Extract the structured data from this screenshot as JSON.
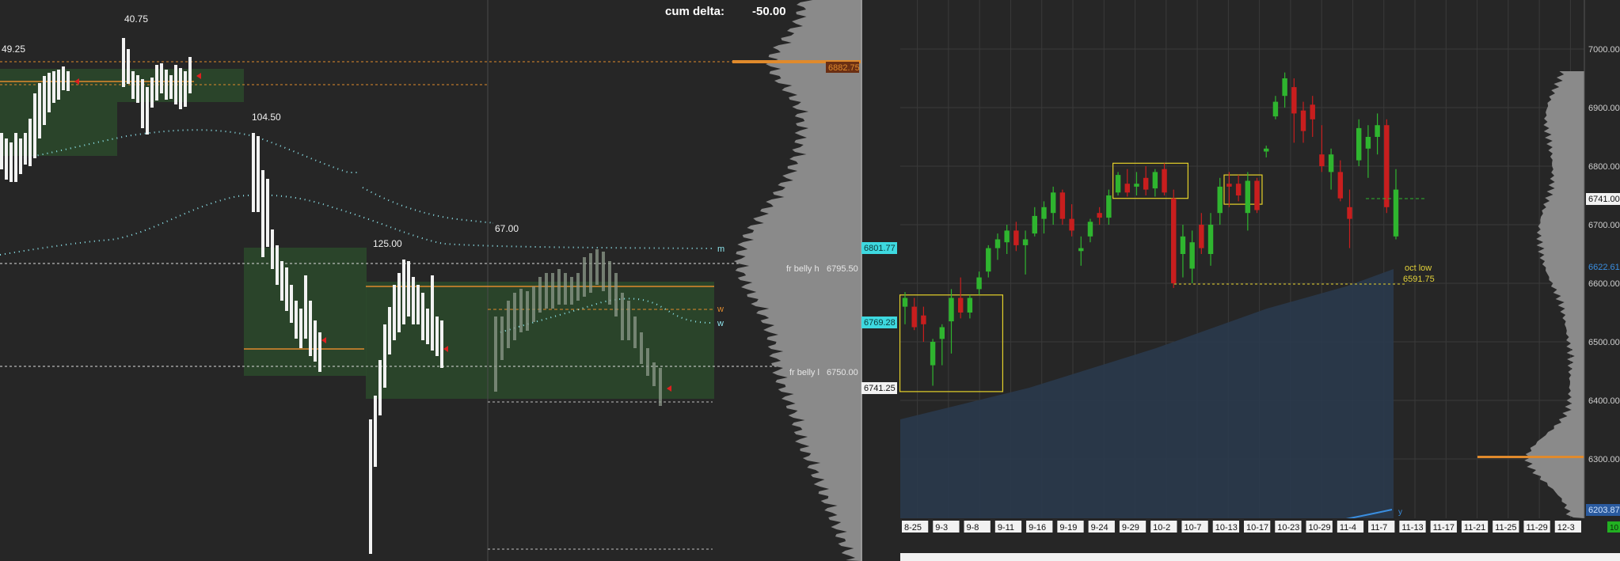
{
  "colors": {
    "background": "#262626",
    "grid": "#3a3a3a",
    "bull": "#2fb52f",
    "bear": "#c81e1e",
    "box_yellow": "#e6d22a",
    "cyan": "#8ee6ee",
    "orange": "#e08a2c",
    "profile_gray": "#8a8a8a",
    "value_area": "#2c4a2c",
    "vwap_fill": "#2a3a4c"
  },
  "icons": {
    "tpo_marker": "red-triangle-icon"
  },
  "left_panel": {
    "cum_delta_label": "cum delta:",
    "cum_delta_value": "-50.00",
    "session_labels": [
      "49.25",
      "40.75",
      "104.50",
      "125.00",
      "67.00"
    ],
    "level_lines": [
      {
        "label": "",
        "value": "6882.75",
        "tag": "6882.75"
      },
      {
        "label": "fr belly h",
        "value": "6795.50"
      },
      {
        "label": "fr belly l",
        "value": "6750.00"
      }
    ],
    "line_markers": [
      "m",
      "w",
      "w"
    ]
  },
  "right_panel": {
    "left_price_tags": [
      "6801.77",
      "6769.28",
      "6741.25"
    ],
    "annotation_label": "oct low",
    "annotation_value": "6591.75",
    "axis_tags": {
      "last_price": "6741.00",
      "profile_level": "6622.61",
      "bottom_level": "6203.87",
      "corner_tag": "10"
    },
    "series_marker": "y"
  },
  "chart_data": [
    {
      "type": "bar",
      "title": "",
      "description_of_content": "Intraday TPO/footprint price ladder with volume profile",
      "xlabel": "",
      "ylabel": "",
      "annotations": [
        "cum delta: -50.00",
        "49.25",
        "40.75",
        "104.50",
        "125.00",
        "67.00",
        "6882.75",
        "fr belly h 6795.50",
        "fr belly l 6750.00",
        "m",
        "w",
        "w"
      ]
    },
    {
      "type": "candlestick",
      "title": "",
      "xlabel": "",
      "ylabel": "",
      "x_ticks": [
        "8-25",
        "9-3",
        "9-8",
        "9-11",
        "9-16",
        "9-19",
        "9-24",
        "9-29",
        "10-2",
        "10-7",
        "10-13",
        "10-17",
        "10-23",
        "10-29",
        "11-4",
        "11-7",
        "11-13",
        "11-17",
        "11-21",
        "11-25",
        "11-29",
        "12-3"
      ],
      "y_ticks": [
        6300,
        6400,
        6500,
        6600,
        6700,
        6800,
        6900,
        7000
      ],
      "ylim": [
        6190,
        7065
      ],
      "candles": [
        {
          "o": 6560,
          "h": 6585,
          "l": 6530,
          "c": 6575
        },
        {
          "o": 6560,
          "h": 6575,
          "l": 6520,
          "c": 6525
        },
        {
          "o": 6545,
          "h": 6560,
          "l": 6500,
          "c": 6530
        },
        {
          "o": 6460,
          "h": 6505,
          "l": 6425,
          "c": 6500
        },
        {
          "o": 6505,
          "h": 6530,
          "l": 6460,
          "c": 6525
        },
        {
          "o": 6535,
          "h": 6590,
          "l": 6480,
          "c": 6575
        },
        {
          "o": 6575,
          "h": 6610,
          "l": 6540,
          "c": 6550
        },
        {
          "o": 6550,
          "h": 6580,
          "l": 6540,
          "c": 6575
        },
        {
          "o": 6590,
          "h": 6620,
          "l": 6580,
          "c": 6610
        },
        {
          "o": 6620,
          "h": 6665,
          "l": 6610,
          "c": 6660
        },
        {
          "o": 6660,
          "h": 6685,
          "l": 6640,
          "c": 6675
        },
        {
          "o": 6670,
          "h": 6700,
          "l": 6650,
          "c": 6690
        },
        {
          "o": 6690,
          "h": 6705,
          "l": 6655,
          "c": 6665
        },
        {
          "o": 6665,
          "h": 6690,
          "l": 6615,
          "c": 6675
        },
        {
          "o": 6685,
          "h": 6730,
          "l": 6680,
          "c": 6715
        },
        {
          "o": 6710,
          "h": 6740,
          "l": 6685,
          "c": 6730
        },
        {
          "o": 6720,
          "h": 6765,
          "l": 6700,
          "c": 6755
        },
        {
          "o": 6755,
          "h": 6760,
          "l": 6700,
          "c": 6710
        },
        {
          "o": 6710,
          "h": 6735,
          "l": 6680,
          "c": 6690
        },
        {
          "o": 6655,
          "h": 6680,
          "l": 6630,
          "c": 6660
        },
        {
          "o": 6680,
          "h": 6710,
          "l": 6670,
          "c": 6705
        },
        {
          "o": 6720,
          "h": 6730,
          "l": 6700,
          "c": 6712
        },
        {
          "o": 6712,
          "h": 6760,
          "l": 6700,
          "c": 6750
        },
        {
          "o": 6755,
          "h": 6790,
          "l": 6750,
          "c": 6785
        },
        {
          "o": 6770,
          "h": 6795,
          "l": 6748,
          "c": 6755
        },
        {
          "o": 6765,
          "h": 6790,
          "l": 6750,
          "c": 6770
        },
        {
          "o": 6780,
          "h": 6800,
          "l": 6750,
          "c": 6760
        },
        {
          "o": 6762,
          "h": 6795,
          "l": 6748,
          "c": 6790
        },
        {
          "o": 6795,
          "h": 6805,
          "l": 6750,
          "c": 6755
        },
        {
          "o": 6745,
          "h": 6760,
          "l": 6592,
          "c": 6600
        },
        {
          "o": 6650,
          "h": 6700,
          "l": 6610,
          "c": 6680
        },
        {
          "o": 6625,
          "h": 6690,
          "l": 6600,
          "c": 6670
        },
        {
          "o": 6700,
          "h": 6720,
          "l": 6650,
          "c": 6660
        },
        {
          "o": 6650,
          "h": 6720,
          "l": 6630,
          "c": 6700
        },
        {
          "o": 6720,
          "h": 6780,
          "l": 6700,
          "c": 6765
        },
        {
          "o": 6770,
          "h": 6790,
          "l": 6730,
          "c": 6765
        },
        {
          "o": 6770,
          "h": 6785,
          "l": 6740,
          "c": 6750
        },
        {
          "o": 6720,
          "h": 6790,
          "l": 6690,
          "c": 6775
        },
        {
          "o": 6775,
          "h": 6780,
          "l": 6720,
          "c": 6725
        },
        {
          "o": 6825,
          "h": 6835,
          "l": 6815,
          "c": 6830
        },
        {
          "o": 6885,
          "h": 6920,
          "l": 6880,
          "c": 6910
        },
        {
          "o": 6920,
          "h": 6960,
          "l": 6900,
          "c": 6950
        },
        {
          "o": 6935,
          "h": 6950,
          "l": 6840,
          "c": 6890
        },
        {
          "o": 6895,
          "h": 6910,
          "l": 6840,
          "c": 6860
        },
        {
          "o": 6905,
          "h": 6920,
          "l": 6850,
          "c": 6880
        },
        {
          "o": 6820,
          "h": 6870,
          "l": 6790,
          "c": 6800
        },
        {
          "o": 6790,
          "h": 6830,
          "l": 6760,
          "c": 6820
        },
        {
          "o": 6790,
          "h": 6810,
          "l": 6740,
          "c": 6745
        },
        {
          "o": 6730,
          "h": 6760,
          "l": 6660,
          "c": 6710
        },
        {
          "o": 6810,
          "h": 6880,
          "l": 6800,
          "c": 6865
        },
        {
          "o": 6830,
          "h": 6870,
          "l": 6780,
          "c": 6850
        },
        {
          "o": 6850,
          "h": 6890,
          "l": 6820,
          "c": 6870
        },
        {
          "o": 6870,
          "h": 6880,
          "l": 6720,
          "c": 6730
        },
        {
          "o": 6680,
          "h": 6795,
          "l": 6675,
          "c": 6760
        }
      ],
      "boxes": [
        {
          "from_index": 0,
          "to_index": 10,
          "low": 6415,
          "high": 6580
        },
        {
          "from_index": 23,
          "to_index": 30,
          "low": 6745,
          "high": 6805
        },
        {
          "from_index": 35,
          "to_index": 38,
          "low": 6735,
          "high": 6785
        }
      ],
      "annotations": [
        "oct low 6591.75"
      ],
      "axis_tags": [
        "6741.00",
        "6622.61",
        "6203.87"
      ],
      "grid": true
    }
  ]
}
